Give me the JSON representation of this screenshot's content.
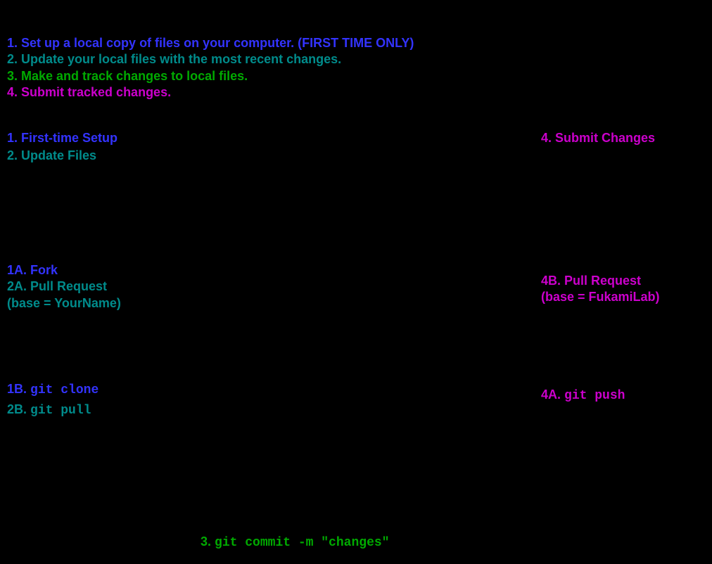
{
  "legend": {
    "l1": {
      "num": "1.",
      "text": " Set up a local copy of files on your computer. (FIRST TIME ONLY)"
    },
    "l2": {
      "num": "2.",
      "text": " Update your local files with the most recent changes."
    },
    "l3": {
      "num": "3.",
      "text": " Make and track changes to local files."
    },
    "l4": {
      "num": "4.",
      "text": " Submit tracked changes."
    }
  },
  "sections": {
    "s1": "1. First-time Setup",
    "s2": "2. Update Files",
    "s4": "4. Submit Changes"
  },
  "notes": {
    "left": {
      "a": "1A. Fork",
      "b": "2A. Pull Request",
      "c": "(base = YourName)"
    },
    "right": {
      "a": "4B. Pull Request",
      "b": "(base = FukamiLab)"
    }
  },
  "cmds": {
    "left": {
      "l1_prefix": "1B.",
      "l1_code": "git clone",
      "l2_prefix": "2B.",
      "l2_code": "git pull"
    },
    "right": {
      "prefix": "4A.",
      "code": "git push"
    }
  },
  "commit": {
    "prefix": "3.",
    "code": "git commit -m \"changes\""
  }
}
